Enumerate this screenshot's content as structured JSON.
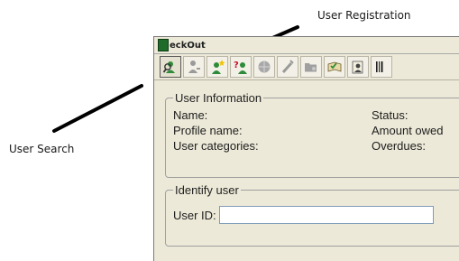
{
  "annotations": {
    "user_registration": "User Registration",
    "user_search": "User Search"
  },
  "window": {
    "title": "eckOut"
  },
  "toolbar": {
    "buttons": [
      {
        "icon": "user-search-icon",
        "active": true
      },
      {
        "icon": "user-disabled-icon",
        "active": false
      },
      {
        "icon": "user-registration-icon",
        "active": false
      },
      {
        "icon": "user-help-icon",
        "active": false
      },
      {
        "icon": "globe-disabled-icon",
        "active": false
      },
      {
        "icon": "wand-disabled-icon",
        "active": false
      },
      {
        "icon": "folder-user-disabled-icon",
        "active": false
      },
      {
        "icon": "book-check-icon",
        "active": false
      },
      {
        "icon": "book-user-icon",
        "active": false
      },
      {
        "icon": "barcode-icon",
        "active": false
      }
    ]
  },
  "user_information": {
    "legend": "User Information",
    "name_label": "Name:",
    "status_label": "Status:",
    "profile_label": "Profile name:",
    "amount_label": "Amount owed",
    "categories_label": "User categories:",
    "overdues_label": "Overdues:"
  },
  "identify_user": {
    "legend": "Identify user",
    "user_id_label": "User ID:",
    "user_id_value": ""
  },
  "colors": {
    "window_bg": "#ece9d8",
    "accent_green": "#1e6b2a"
  }
}
